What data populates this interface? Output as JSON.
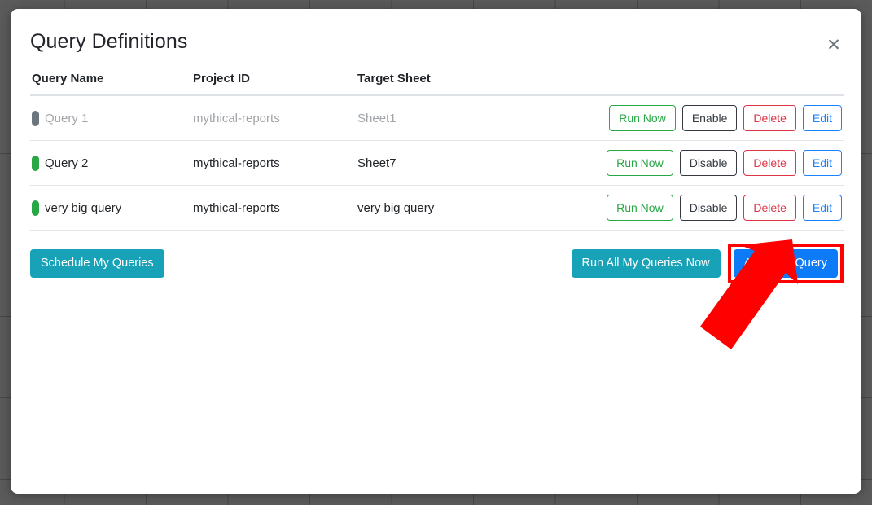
{
  "modal": {
    "title": "Query Definitions",
    "close_icon": "close-icon",
    "close_glyph": "✕"
  },
  "table": {
    "columns": [
      "Query Name",
      "Project ID",
      "Target Sheet"
    ],
    "actions_header": "",
    "rows": [
      {
        "name": "Query 1",
        "project_id": "mythical-reports",
        "target_sheet": "Sheet1",
        "status": "off",
        "enabled": false,
        "actions": {
          "run": "Run Now",
          "toggle": "Enable",
          "delete": "Delete",
          "edit": "Edit"
        }
      },
      {
        "name": "Query 2",
        "project_id": "mythical-reports",
        "target_sheet": "Sheet7",
        "status": "on",
        "enabled": true,
        "actions": {
          "run": "Run Now",
          "toggle": "Disable",
          "delete": "Delete",
          "edit": "Edit"
        }
      },
      {
        "name": "very big query",
        "project_id": "mythical-reports",
        "target_sheet": "very big query",
        "status": "on",
        "enabled": true,
        "actions": {
          "run": "Run Now",
          "toggle": "Disable",
          "delete": "Delete",
          "edit": "Edit"
        }
      }
    ]
  },
  "footer": {
    "schedule_label": "Schedule My Queries",
    "run_all_label": "Run All My Queries Now",
    "add_new_label": "Add New Query"
  },
  "colors": {
    "accent_primary": "#0d7bf7",
    "accent_info": "#17a2b8",
    "status_on": "#28a745",
    "status_off": "#6c757d",
    "danger": "#dc3545",
    "annotation": "#ff0000",
    "backdrop": "#5b5b5b"
  }
}
